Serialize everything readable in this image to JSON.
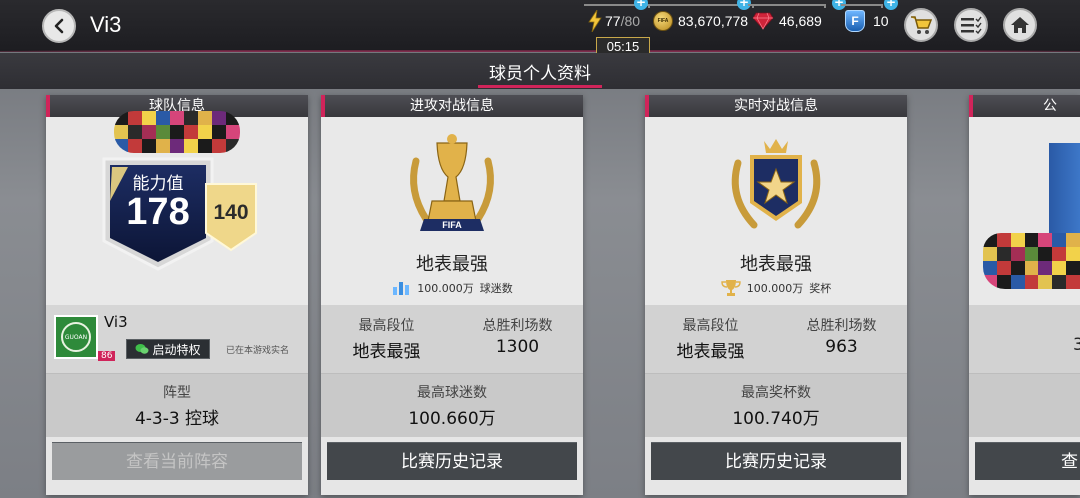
{
  "header": {
    "title": "Vi3",
    "energy_current": "77",
    "energy_max": "/80",
    "coins": "83,670,778",
    "coin_label": "FIFA",
    "gems": "46,689",
    "f_points": "10",
    "f_badge": "F",
    "timer": "05:15"
  },
  "tabs": [
    {
      "label": "球员个人资料"
    }
  ],
  "cards": {
    "team": {
      "header": "球队信息",
      "rating_label": "能力值",
      "rating_value": "178",
      "secondary_rating": "140",
      "player_name": "Vi3",
      "level_badge": "86",
      "privilege_button": "启动特权",
      "verified_note": "已在本游戏实名",
      "formation_label": "阵型",
      "formation_value": "4-3-3 控球",
      "view_lineup_button": "查看当前阵容",
      "club_logo_text": "GUOAN"
    },
    "attack": {
      "header": "进攻对战信息",
      "trophy_text": "FIFA",
      "rank_title": "地表最强",
      "sub_value": "100.000万",
      "sub_label": "球迷数",
      "highest_rank_label": "最高段位",
      "highest_rank_value": "地表最强",
      "total_wins_label": "总胜利场数",
      "total_wins_value": "1300",
      "peak_fans_label": "最高球迷数",
      "peak_fans_value": "100.660万",
      "history_button": "比赛历史记录"
    },
    "live": {
      "header": "实时对战信息",
      "rank_title": "地表最强",
      "sub_value": "100.000万",
      "sub_label": "奖杯",
      "highest_rank_label": "最高段位",
      "highest_rank_value": "地表最强",
      "total_wins_label": "总胜利场数",
      "total_wins_value": "963",
      "peak_trophies_label": "最高奖杯数",
      "peak_trophies_value": "100.740万",
      "history_button": "比赛历史记录"
    },
    "partial": {
      "header": "公",
      "mid_value": "3",
      "button": "查"
    }
  },
  "colors": {
    "accent": "#d0245a",
    "plus": "#3fb3e6",
    "button_dark": "#43474b",
    "card_bg": "#e6e6e6"
  },
  "icons": [
    "back-icon",
    "lightning-icon",
    "coin-icon",
    "gem-icon",
    "f-points-icon",
    "cart-icon",
    "menu-list-icon",
    "home-icon",
    "wechat-icon",
    "fans-icon",
    "trophy-icon"
  ]
}
